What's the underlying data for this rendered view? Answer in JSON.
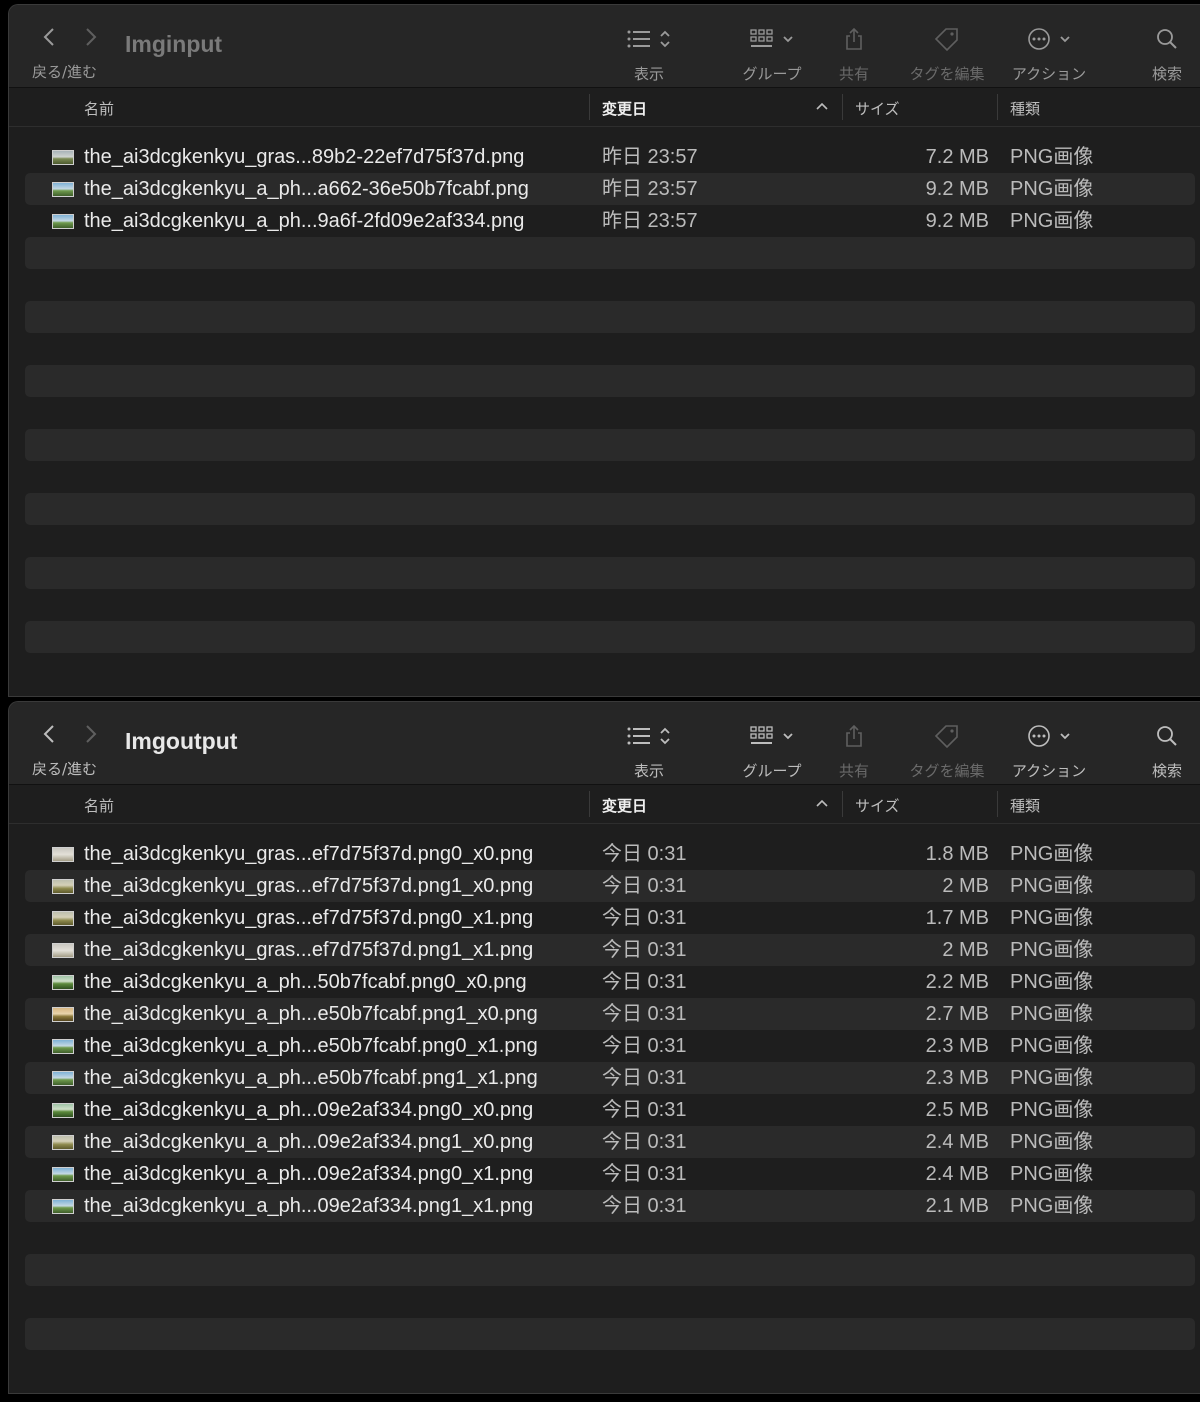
{
  "toolbar": {
    "nav_label": "戻る/進む",
    "view_label": "表示",
    "group_label": "グループ",
    "share_label": "共有",
    "tags_label": "タグを編集",
    "action_label": "アクション",
    "search_label": "検索"
  },
  "columns": {
    "name": "名前",
    "date": "変更日",
    "size": "サイズ",
    "kind": "種類"
  },
  "windows": [
    {
      "title": "Imginput",
      "files": [
        {
          "name": "the_ai3dcgkenkyu_gras...89b2-22ef7d75f37d.png",
          "date": "昨日 23:57",
          "size": "7.2 MB",
          "kind": "PNG画像",
          "thumb": "landscape"
        },
        {
          "name": "the_ai3dcgkenkyu_a_ph...a662-36e50b7fcabf.png",
          "date": "昨日 23:57",
          "size": "9.2 MB",
          "kind": "PNG画像",
          "thumb": "sky"
        },
        {
          "name": "the_ai3dcgkenkyu_a_ph...9a6f-2fd09e2af334.png",
          "date": "昨日 23:57",
          "size": "9.2 MB",
          "kind": "PNG画像",
          "thumb": "sky"
        }
      ]
    },
    {
      "title": "Imgoutput",
      "files": [
        {
          "name": "the_ai3dcgkenkyu_gras...ef7d75f37d.png0_x0.png",
          "date": "今日 0:31",
          "size": "1.8 MB",
          "kind": "PNG画像",
          "thumb": "pale"
        },
        {
          "name": "the_ai3dcgkenkyu_gras...ef7d75f37d.png1_x0.png",
          "date": "今日 0:31",
          "size": "2 MB",
          "kind": "PNG画像",
          "thumb": "field"
        },
        {
          "name": "the_ai3dcgkenkyu_gras...ef7d75f37d.png0_x1.png",
          "date": "今日 0:31",
          "size": "1.7 MB",
          "kind": "PNG画像",
          "thumb": "field"
        },
        {
          "name": "the_ai3dcgkenkyu_gras...ef7d75f37d.png1_x1.png",
          "date": "今日 0:31",
          "size": "2 MB",
          "kind": "PNG画像",
          "thumb": "pale"
        },
        {
          "name": "the_ai3dcgkenkyu_a_ph...50b7fcabf.png0_x0.png",
          "date": "今日 0:31",
          "size": "2.2 MB",
          "kind": "PNG画像",
          "thumb": "green"
        },
        {
          "name": "the_ai3dcgkenkyu_a_ph...e50b7fcabf.png1_x0.png",
          "date": "今日 0:31",
          "size": "2.7 MB",
          "kind": "PNG画像",
          "thumb": "warm"
        },
        {
          "name": "the_ai3dcgkenkyu_a_ph...e50b7fcabf.png0_x1.png",
          "date": "今日 0:31",
          "size": "2.3 MB",
          "kind": "PNG画像",
          "thumb": "sky"
        },
        {
          "name": "the_ai3dcgkenkyu_a_ph...e50b7fcabf.png1_x1.png",
          "date": "今日 0:31",
          "size": "2.3 MB",
          "kind": "PNG画像",
          "thumb": "sky"
        },
        {
          "name": "the_ai3dcgkenkyu_a_ph...09e2af334.png0_x0.png",
          "date": "今日 0:31",
          "size": "2.5 MB",
          "kind": "PNG画像",
          "thumb": "green"
        },
        {
          "name": "the_ai3dcgkenkyu_a_ph...09e2af334.png1_x0.png",
          "date": "今日 0:31",
          "size": "2.4 MB",
          "kind": "PNG画像",
          "thumb": "field"
        },
        {
          "name": "the_ai3dcgkenkyu_a_ph...09e2af334.png0_x1.png",
          "date": "今日 0:31",
          "size": "2.4 MB",
          "kind": "PNG画像",
          "thumb": "sky"
        },
        {
          "name": "the_ai3dcgkenkyu_a_ph...09e2af334.png1_x1.png",
          "date": "今日 0:31",
          "size": "2.1 MB",
          "kind": "PNG画像",
          "thumb": "sky"
        }
      ]
    }
  ],
  "colors": {
    "window_bg": "#1e1e1e",
    "toolbar_bg": "#262626",
    "stripe": "#2a2a2a",
    "text": "#eaeaea",
    "secondary_text": "#bbbbbb"
  },
  "thumb_styles": {
    "landscape": "linear-gradient(#a9b3b8 0%, #cfd3cf 45%, #7b8a54 60%, #4d5a2e 100%)",
    "sky": "linear-gradient(#7fb2d6 0%, #c4d8e3 45%, #6f9a4d 60%, #3f5e2b 100%)",
    "pale": "linear-gradient(#c9c7c0 0%, #e3e0d8 50%, #a39d86 100%)",
    "field": "linear-gradient(#bdbfae 0%, #d5d1b8 40%, #8e8a4e 65%, #5e5a2c 100%)",
    "green": "linear-gradient(#9fc3a6 0%, #cfe0c9 40%, #5c8a3c 60%, #2f4f20 100%)",
    "warm": "linear-gradient(#d9b884 0%, #e8d3ab 45%, #8d7a3c 65%, #54441e 100%)"
  }
}
